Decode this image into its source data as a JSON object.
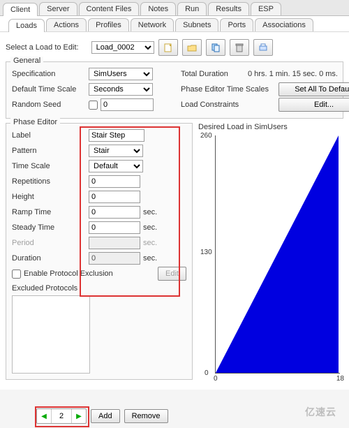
{
  "tabs_top": [
    "Client",
    "Server",
    "Content Files",
    "Notes",
    "Run",
    "Results",
    "ESP"
  ],
  "tabs_top_active": 0,
  "tabs_sub": [
    "Loads",
    "Actions",
    "Profiles",
    "Network",
    "Subnets",
    "Ports",
    "Associations"
  ],
  "tabs_sub_active": 0,
  "toolbar": {
    "select_label": "Select a Load to Edit:",
    "selected_load": "Load_0002"
  },
  "general": {
    "title": "General",
    "left": {
      "spec_label": "Specification",
      "spec_value": "SimUsers",
      "tscale_label": "Default Time Scale",
      "tscale_value": "Seconds",
      "seed_label": "Random Seed",
      "seed_value": "0"
    },
    "right": {
      "dur_label": "Total Duration",
      "dur_value": "0 hrs. 1 min. 15 sec. 0 ms.",
      "scales_label": "Phase Editor Time Scales",
      "scales_btn": "Set All To Default",
      "constraints_label": "Load Constraints",
      "constraints_btn": "Edit..."
    }
  },
  "phase_editor": {
    "title": "Phase Editor",
    "label_label": "Label",
    "label_value": "Stair Step",
    "pattern_label": "Pattern",
    "pattern_value": "Stair",
    "tscale_label": "Time Scale",
    "tscale_value": "Default",
    "reps_label": "Repetitions",
    "reps_value": "0",
    "height_label": "Height",
    "height_value": "0",
    "ramp_label": "Ramp Time",
    "ramp_value": "0",
    "steady_label": "Steady Time",
    "steady_value": "0",
    "period_label": "Period",
    "period_value": "",
    "duration_label": "Duration",
    "duration_value": "0",
    "sec": "sec.",
    "enable_excl_label": "Enable Protocol Exclusion",
    "edit_btn": "Edit",
    "excl_title": "Excluded Protocols"
  },
  "chart": {
    "title": "Desired Load in SimUsers",
    "y_ticks": [
      "0",
      "130",
      "260"
    ],
    "x_ticks": [
      "0",
      "18"
    ]
  },
  "chart_data": {
    "type": "line",
    "title": "Desired Load in SimUsers",
    "x": [
      0,
      18
    ],
    "y": [
      0,
      260
    ],
    "xlabel": "",
    "ylabel": "",
    "xlim": [
      0,
      18
    ],
    "ylim": [
      0,
      260
    ],
    "note": "Single ramp from (0,0) to (~18,260); area under curve filled blue."
  },
  "footer": {
    "page": "2",
    "add": "Add",
    "remove": "Remove"
  },
  "watermark": "亿速云"
}
